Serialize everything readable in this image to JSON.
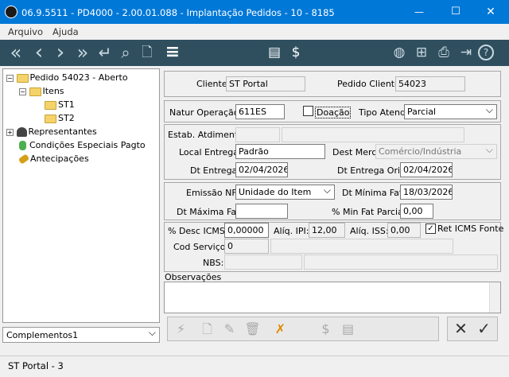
{
  "window": {
    "title": "06.9.5511 - PD4000 - 2.00.01.088 - Implantação Pedidos - 10 - 8185",
    "minimize": "—",
    "maximize": "☐",
    "close": "✕"
  },
  "menu": {
    "arquivo": "Arquivo",
    "ajuda": "Ajuda"
  },
  "toolbar": {
    "first": "«",
    "prev": "‹",
    "next": "›",
    "last": "»",
    "return": "↵",
    "search": "⌕",
    "doc": "🗋",
    "settings": "≡",
    "report": "▤",
    "money": "$",
    "globe": "◍",
    "network": "⊞",
    "print": "⎙",
    "exit": "⇥",
    "help": "?"
  },
  "tree": {
    "pedido": "Pedido 54023 - Aberto",
    "itens": "Itens",
    "st1": "ST1",
    "st2": "ST2",
    "representantes": "Representantes",
    "condicoes": "Condições Especiais Pagto",
    "antecipacoes": "Antecipações"
  },
  "complementos": {
    "value": "Complementos1"
  },
  "header": {
    "cliente_label": "Cliente:",
    "cliente_value": "ST Portal",
    "pedido_label": "Pedido Cliente:",
    "pedido_value": "54023"
  },
  "natur": {
    "label": "Natur Operação:",
    "value": "611ES",
    "doacao_label": "Doação",
    "tipo_label": "Tipo Atend:",
    "tipo_value": "Parcial"
  },
  "estab": {
    "label": "Estab. Atdimento:",
    "local_label": "Local Entrega:",
    "local_value": "Padrão",
    "dest_label": "Dest Merc:",
    "dest_value": "Comércio/Indústria",
    "dt_entrega_label": "Dt Entrega:",
    "dt_entrega_value": "02/04/2026",
    "dt_orig_label": "Dt Entrega Orig:",
    "dt_orig_value": "02/04/2026"
  },
  "emissao": {
    "label": "Emissão NF:",
    "value": "Unidade do Item",
    "dt_min_label": "Dt Mínima Fat:",
    "dt_min_value": "18/03/2026",
    "dt_max_label": "Dt Máxima Fat:",
    "dt_max_value": "",
    "min_fat_label": "% Min Fat Parcial:",
    "min_fat_value": "0,00"
  },
  "icms": {
    "desc_label": "% Desc ICMS:",
    "desc_value": "0,00000",
    "ipi_label": "Alíq. IPI:",
    "ipi_value": "12,00",
    "iss_label": "Alíq. ISS:",
    "iss_value": "0,00",
    "ret_label": "Ret ICMS Fonte",
    "cod_label": "Cod Serviço:",
    "cod_value": "0",
    "nbs_label": "NBS:"
  },
  "obs": {
    "label": "Observações"
  },
  "status": {
    "text": "ST Portal - 3"
  }
}
